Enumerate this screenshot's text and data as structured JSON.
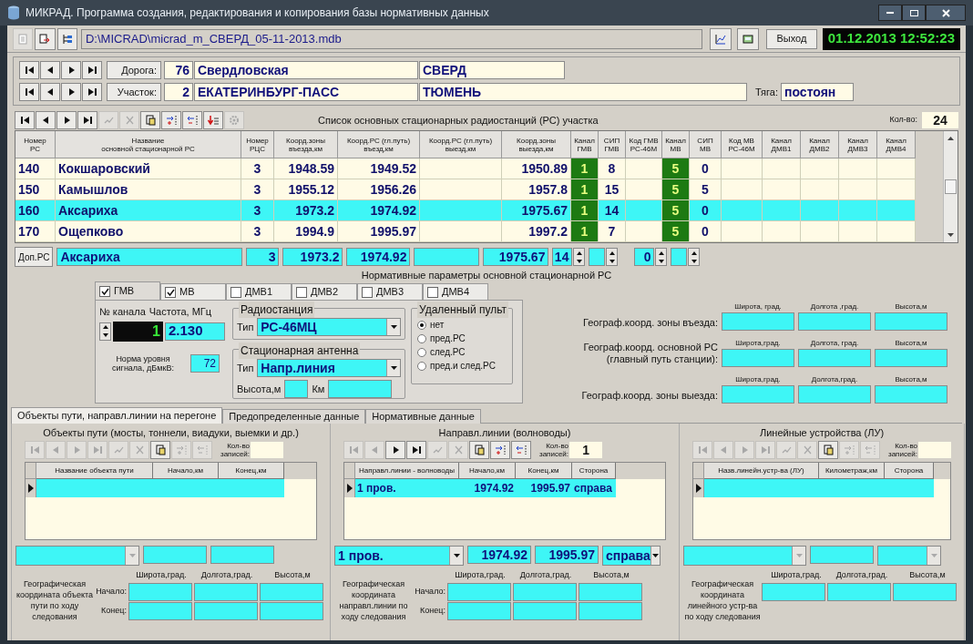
{
  "window": {
    "title": "МИКРАД. Программа создания, редактирования и копирования базы нормативных данных"
  },
  "toolbar": {
    "left_tools": [
      {
        "kind": "doc",
        "disabled": true
      },
      {
        "kind": "export",
        "disabled": false
      },
      {
        "kind": "tree",
        "disabled": false
      }
    ],
    "path": "D:\\MICRAD\\micrad_m_СВЕРД_05-11-2013.mdb",
    "right_tools": [
      {
        "kind": "chart",
        "disabled": false
      },
      {
        "kind": "disk",
        "disabled": false
      }
    ],
    "exit_button": "Выход",
    "clock": "01.12.2013 12:52:23"
  },
  "road": {
    "label": "Дорога:",
    "number": "76",
    "name": "Свердловская",
    "code": "СВЕРД"
  },
  "section": {
    "label": "Участок:",
    "number": "2",
    "from": "ЕКАТЕРИНБУРГ-ПАСС",
    "to": "ТЮМЕНЬ",
    "traction_label": "Тяга:",
    "traction": "постоян"
  },
  "stations": {
    "tools": [
      {
        "kind": "first",
        "disabled": false
      },
      {
        "kind": "prev",
        "disabled": false
      },
      {
        "kind": "next",
        "disabled": false
      },
      {
        "kind": "last",
        "disabled": false
      },
      {
        "kind": "edit",
        "disabled": true
      },
      {
        "kind": "cancel",
        "disabled": true
      },
      {
        "kind": "copy",
        "disabled": false
      },
      {
        "kind": "add",
        "disabled": false
      },
      {
        "kind": "remove",
        "disabled": false
      },
      {
        "kind": "km",
        "disabled": false
      },
      {
        "kind": "gear",
        "disabled": true
      }
    ],
    "title": "Список основных стационарных радиостанций (РС) участка",
    "count_label": "Кол-во:",
    "count": "24",
    "columns": [
      {
        "label": "Номер\nРС",
        "kind": "text"
      },
      {
        "label": "Название\nосновной стационарной РС",
        "kind": "text"
      },
      {
        "label": "Номер\nРЦС",
        "kind": "center"
      },
      {
        "label": "Коорд.зоны\nвъезда,км",
        "kind": "num"
      },
      {
        "label": "Коорд.РС (гл.путь)\nвъезд,км",
        "kind": "num"
      },
      {
        "label": "Коорд.РС (гл.путь)\nвыезд,км",
        "kind": "num"
      },
      {
        "label": "Коорд.зоны\nвыезда,км",
        "kind": "num"
      },
      {
        "label": "Канал\nГМВ",
        "kind": "channel"
      },
      {
        "label": "СИП\nГМВ",
        "kind": "center"
      },
      {
        "label": "Код ГМВ\nРС-46М",
        "kind": "center"
      },
      {
        "label": "Канал\nМВ",
        "kind": "channel"
      },
      {
        "label": "СИП\nМВ",
        "kind": "center"
      },
      {
        "label": "Код МВ\nРС-46М",
        "kind": "center"
      },
      {
        "label": "Канал\nДМВ1",
        "kind": "center"
      },
      {
        "label": "Канал\nДМВ2",
        "kind": "center"
      },
      {
        "label": "Канал\nДМВ3",
        "kind": "center"
      },
      {
        "label": "Канал\nДМВ4",
        "kind": "center"
      }
    ],
    "rows": [
      {
        "selected": false,
        "cells": [
          "140",
          "Кокшаровский",
          "3",
          "1948.59",
          "1949.52",
          null,
          "1950.89",
          "1",
          "8",
          null,
          "5",
          "0",
          null,
          null,
          null,
          null,
          null
        ]
      },
      {
        "selected": false,
        "cells": [
          "150",
          "Камышлов",
          "3",
          "1955.12",
          "1956.26",
          null,
          "1957.8",
          "1",
          "15",
          null,
          "5",
          "5",
          null,
          null,
          null,
          null,
          null
        ]
      },
      {
        "selected": true,
        "cells": [
          "160",
          "Аксариха",
          "3",
          "1973.2",
          "1974.92",
          null,
          "1975.67",
          "1",
          "14",
          null,
          "5",
          "0",
          null,
          null,
          null,
          null,
          null
        ]
      },
      {
        "selected": false,
        "cells": [
          "170",
          "Ощепково",
          "3",
          "1994.9",
          "1995.97",
          null,
          "1997.2",
          "1",
          "7",
          null,
          "5",
          "0",
          null,
          null,
          null,
          null,
          null
        ]
      }
    ],
    "editor": {
      "button": "Доп.РС",
      "fields": [
        {
          "kind": "text",
          "value": "Аксариха"
        },
        {
          "kind": "num",
          "value": "3"
        },
        {
          "kind": "num",
          "value": "1973.2"
        },
        {
          "kind": "num",
          "value": "1974.92"
        },
        {
          "kind": "num"
        },
        {
          "kind": "num",
          "value": "1975.67"
        },
        {
          "kind": "spin",
          "value": "14"
        },
        {
          "kind": "spin"
        },
        {
          "kind": "spin",
          "value": "0"
        },
        {
          "kind": "spin"
        }
      ]
    }
  },
  "norm": {
    "title": "Нормативные параметры основной стационарной РС",
    "bands": [
      {
        "label": "ГМВ",
        "checked": true,
        "selected": true
      },
      {
        "label": "МВ",
        "checked": true,
        "selected": false
      },
      {
        "label": "ДМВ1",
        "checked": false,
        "selected": false
      },
      {
        "label": "ДМВ2",
        "checked": false,
        "selected": false
      },
      {
        "label": "ДМВ3",
        "checked": false,
        "selected": false
      },
      {
        "label": "ДМВ4",
        "checked": false,
        "selected": false
      }
    ],
    "channel_label": "№ канала",
    "channel": "1",
    "frequency_label": "Частота, МГц",
    "frequency": "2.130",
    "level_label": "Норма уровня сигнала, дБмкВ:",
    "level_value": "72",
    "radio": {
      "title": "Радиостанция",
      "type_label": "Тип",
      "type": "РС-46МЦ"
    },
    "antenna": {
      "title": "Стационарная антенна",
      "type_label": "Тип",
      "type": "Напр.линия",
      "height_label": "Высота,м",
      "km_label": "Км"
    },
    "remote": {
      "title": "Удаленный пульт",
      "options": [
        {
          "label": "нет",
          "selected": true
        },
        {
          "label": "пред.РС",
          "selected": false
        },
        {
          "label": "след.РС",
          "selected": false
        },
        {
          "label": "пред.и след.РС",
          "selected": false
        }
      ]
    },
    "geo": [
      {
        "label": "Географ.коорд. зоны въезда:",
        "columns": [
          "Широта, град.",
          "Долгота ,град.",
          "Высота,м"
        ]
      },
      {
        "label": "Географ.коорд. основной РС\n(главный путь станции):",
        "columns": [
          "Широта,град.",
          "Долгота, град.",
          "Высота,м"
        ]
      },
      {
        "label": "Географ.коорд. зоны выезда:",
        "columns": [
          "Широта,град.",
          "Долгота,град.",
          "Высота,м"
        ]
      }
    ]
  },
  "tabs": [
    {
      "label": "Объекты пути, направл.линии на перегоне",
      "selected": true
    },
    {
      "label": "Предопределенные данные",
      "selected": false
    },
    {
      "label": "Нормативные данные",
      "selected": false
    }
  ],
  "panels": [
    {
      "title": "Объекты пути (мосты, тоннели, виадуки, выемки и др.)",
      "tools": [
        {
          "kind": "first",
          "disabled": true
        },
        {
          "kind": "prev",
          "disabled": true
        },
        {
          "kind": "next",
          "disabled": true
        },
        {
          "kind": "last",
          "disabled": true
        },
        {
          "kind": "edit",
          "disabled": true
        },
        {
          "kind": "cancel",
          "disabled": true
        },
        {
          "kind": "copy",
          "disabled": false
        },
        {
          "kind": "add",
          "disabled": true
        },
        {
          "kind": "remove",
          "disabled": true
        }
      ],
      "count_label": "Кол-во\nзаписей:",
      "columns": [
        {
          "label": "Название объекта пути",
          "kind": "text"
        },
        {
          "label": "Начало,км",
          "kind": "num"
        },
        {
          "label": "Конец,км",
          "kind": "num"
        }
      ],
      "rows": [
        {
          "selected": true,
          "cells": [
            null,
            null,
            null
          ]
        }
      ],
      "editor": [
        {
          "kind": "combo",
          "disabled": true
        },
        {
          "kind": "text"
        },
        {
          "kind": "text"
        }
      ],
      "geo": {
        "label": "Географическая координата объекта пути по ходу следования",
        "columns": [
          "Широта,град.",
          "Долгота,град.",
          "Высота,м"
        ],
        "rows": [
          "Начало:",
          "Конец:"
        ]
      }
    },
    {
      "title": "Направл.линии (волноводы)",
      "tools": [
        {
          "kind": "first",
          "disabled": true
        },
        {
          "kind": "prev",
          "disabled": true
        },
        {
          "kind": "next",
          "disabled": false
        },
        {
          "kind": "last",
          "disabled": false
        },
        {
          "kind": "edit",
          "disabled": true
        },
        {
          "kind": "cancel",
          "disabled": true
        },
        {
          "kind": "copy",
          "disabled": false
        },
        {
          "kind": "add",
          "disabled": false
        },
        {
          "kind": "remove",
          "disabled": false
        }
      ],
      "count_label": "Кол-во\nзаписей:",
      "count": "1",
      "columns": [
        {
          "label": "Направл.линии - волноводы",
          "kind": "text"
        },
        {
          "label": "Начало,км",
          "kind": "num"
        },
        {
          "label": "Конец,км",
          "kind": "num"
        },
        {
          "label": "Сторона",
          "kind": "text"
        }
      ],
      "rows": [
        {
          "selected": true,
          "cells": [
            "1 пров.",
            "1974.92",
            "1995.97",
            "справа"
          ]
        }
      ],
      "editor": [
        {
          "kind": "combo",
          "value": "1 пров.",
          "disabled": false
        },
        {
          "kind": "text",
          "value": "1974.92"
        },
        {
          "kind": "text",
          "value": "1995.97"
        },
        {
          "kind": "combo",
          "value": "справа",
          "disabled": false
        }
      ],
      "geo": {
        "label": "Географическая координата направл.линии по ходу следования",
        "columns": [
          "Широта,град.",
          "Долгота,град.",
          "Высота,м"
        ],
        "rows": [
          "Начало:",
          "Конец:"
        ]
      }
    },
    {
      "title": "Линейные устройства (ЛУ)",
      "tools": [
        {
          "kind": "first",
          "disabled": true
        },
        {
          "kind": "prev",
          "disabled": true
        },
        {
          "kind": "next",
          "disabled": true
        },
        {
          "kind": "last",
          "disabled": true
        },
        {
          "kind": "edit",
          "disabled": true
        },
        {
          "kind": "cancel",
          "disabled": true
        },
        {
          "kind": "copy",
          "disabled": false
        },
        {
          "kind": "add",
          "disabled": true
        },
        {
          "kind": "remove",
          "disabled": true
        }
      ],
      "count_label": "Кол-во\nзаписей:",
      "columns": [
        {
          "label": "Назв.линейн.устр-ва (ЛУ)",
          "kind": "text"
        },
        {
          "label": "Километраж,км",
          "kind": "num"
        },
        {
          "label": "Сторона",
          "kind": "text"
        }
      ],
      "rows": [
        {
          "selected": true,
          "cells": [
            null,
            null,
            null
          ]
        }
      ],
      "editor": [
        {
          "kind": "combo",
          "disabled": true
        },
        {
          "kind": "text"
        },
        {
          "kind": "combo",
          "disabled": true
        }
      ],
      "geo": {
        "label": "Географическая координата линейного устр-ва по ходу следования",
        "columns": [
          "Широта,град.",
          "Долгота,град.",
          "Высота,м"
        ]
      }
    }
  ]
}
